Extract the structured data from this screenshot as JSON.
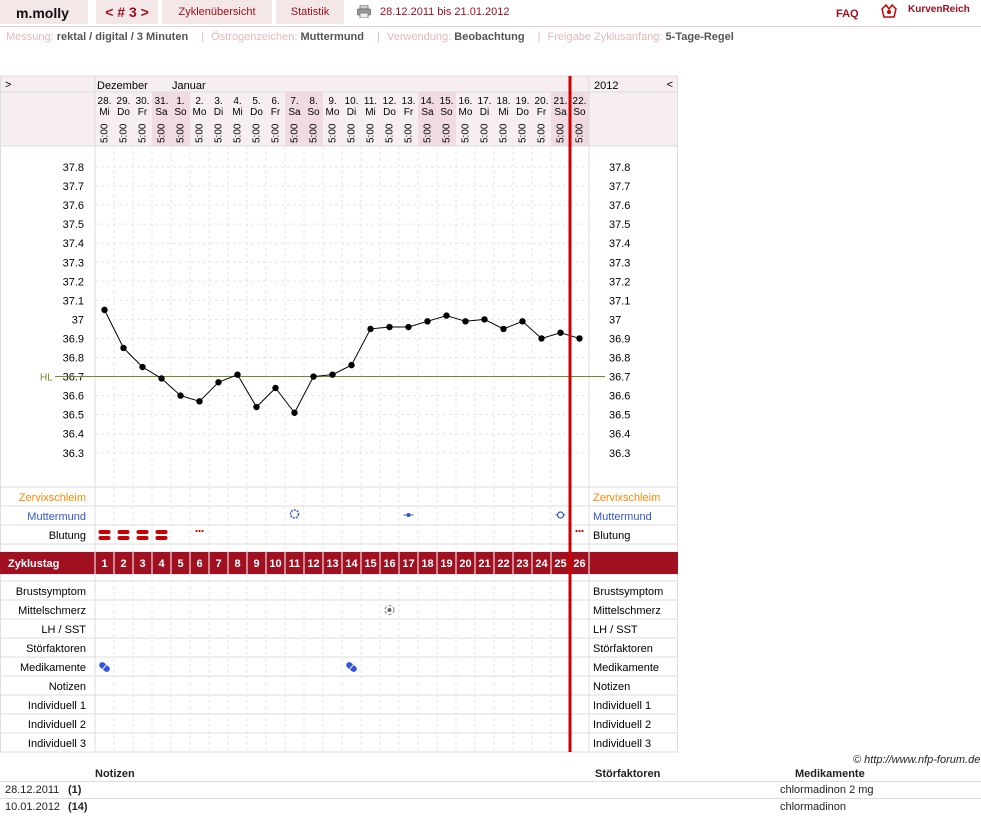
{
  "header": {
    "brand": "m.molly",
    "nav_label": "< # 3 >",
    "tab_overview": "Zyklenübersicht",
    "tab_stats": "Statistik",
    "date_range": "28.12.2011 bis 21.01.2012",
    "faq": "FAQ",
    "logo_text": "KurvenReich",
    "accent_color": "#a01020"
  },
  "info": {
    "measure_label": "Messung:",
    "measure_value": "rektal / digital / 3 Minuten",
    "estro_label": "Östrogenzeichen:",
    "estro_value": "Muttermund",
    "usage_label": "Verwendung:",
    "usage_value": "Beobachtung",
    "release_label": "Freigabe Zyklusanfang:",
    "release_value": "5-Tage-Regel"
  },
  "chart_data": {
    "type": "line",
    "left_marker": ">",
    "right_marker": "<",
    "month_labels": [
      "Dezember",
      "Januar"
    ],
    "year_label": "2012",
    "days": [
      {
        "date": "28.",
        "wd": "Mi",
        "time": "5:00"
      },
      {
        "date": "29.",
        "wd": "Do",
        "time": "5:00"
      },
      {
        "date": "30.",
        "wd": "Fr",
        "time": "5:00"
      },
      {
        "date": "31.",
        "wd": "Sa",
        "time": "5:00"
      },
      {
        "date": "1.",
        "wd": "So",
        "time": "5:00"
      },
      {
        "date": "2.",
        "wd": "Mo",
        "time": "5:00"
      },
      {
        "date": "3.",
        "wd": "Di",
        "time": "5:00"
      },
      {
        "date": "4.",
        "wd": "Mi",
        "time": "5:00"
      },
      {
        "date": "5.",
        "wd": "Do",
        "time": "5:00"
      },
      {
        "date": "6.",
        "wd": "Fr",
        "time": "5:00"
      },
      {
        "date": "7.",
        "wd": "Sa",
        "time": "5:00"
      },
      {
        "date": "8.",
        "wd": "So",
        "time": "5:00"
      },
      {
        "date": "9.",
        "wd": "Mo",
        "time": "5:00"
      },
      {
        "date": "10.",
        "wd": "Di",
        "time": "5:00"
      },
      {
        "date": "11.",
        "wd": "Mi",
        "time": "5:00"
      },
      {
        "date": "12.",
        "wd": "Do",
        "time": "5:00"
      },
      {
        "date": "13.",
        "wd": "Fr",
        "time": "5:00"
      },
      {
        "date": "14.",
        "wd": "Sa",
        "time": "5:00"
      },
      {
        "date": "15.",
        "wd": "So",
        "time": "5:00"
      },
      {
        "date": "16.",
        "wd": "Mo",
        "time": "5:00"
      },
      {
        "date": "17.",
        "wd": "Di",
        "time": "5:00"
      },
      {
        "date": "18.",
        "wd": "Mi",
        "time": "5:00"
      },
      {
        "date": "19.",
        "wd": "Do",
        "time": "5:00"
      },
      {
        "date": "20.",
        "wd": "Fr",
        "time": "5:00"
      },
      {
        "date": "21.",
        "wd": "Sa",
        "time": "5:00"
      },
      {
        "date": "22.",
        "wd": "So",
        "time": "5:00"
      }
    ],
    "cycle_days": [
      1,
      2,
      3,
      4,
      5,
      6,
      7,
      8,
      9,
      10,
      11,
      12,
      13,
      14,
      15,
      16,
      17,
      18,
      19,
      20,
      21,
      22,
      23,
      24,
      25,
      26
    ],
    "temperatures": [
      37.05,
      36.85,
      36.75,
      36.69,
      36.6,
      36.57,
      36.67,
      36.71,
      36.54,
      36.64,
      36.51,
      36.7,
      36.71,
      36.76,
      36.95,
      36.96,
      36.96,
      36.99,
      37.02,
      36.99,
      37.0,
      36.95,
      36.99,
      36.9,
      36.93,
      36.9
    ],
    "y_ticks": [
      "37.8",
      "37.7",
      "37.6",
      "37.5",
      "37.4",
      "37.3",
      "37.2",
      "37.1",
      "37",
      "36.9",
      "36.8",
      "36.7",
      "36.6",
      "36.5",
      "36.4",
      "36.3"
    ],
    "ylim": [
      36.3,
      37.8
    ],
    "hl_label": "HL",
    "hl_value": 36.7,
    "hl_color": "#6b8e23",
    "line_color": "#000000",
    "cycle_start_marker_day": 26,
    "marker_color": "#cc0000",
    "row_labels": {
      "zervix": "Zervixschleim",
      "mumu": "Muttermund",
      "blutung": "Blutung",
      "zyklustag": "Zyklustag",
      "brust": "Brustsymptom",
      "mittel": "Mittelschmerz",
      "lh": "LH / SST",
      "stoer": "Störfaktoren",
      "medi": "Medikamente",
      "notizen": "Notizen",
      "ind1": "Individuell 1",
      "ind2": "Individuell 2",
      "ind3": "Individuell 3"
    },
    "zervix_color": "#ff8800",
    "mumu_color": "#3355cc",
    "bleeding": [
      {
        "day": 1,
        "type": "heavy"
      },
      {
        "day": 2,
        "type": "heavy"
      },
      {
        "day": 3,
        "type": "heavy"
      },
      {
        "day": 4,
        "type": "heavy"
      },
      {
        "day": 6,
        "type": "spotting"
      },
      {
        "day": 26,
        "type": "spotting"
      }
    ],
    "muttermund": [
      {
        "day": 11,
        "type": "open"
      },
      {
        "day": 17,
        "type": "closed"
      },
      {
        "day": 25,
        "type": "medium"
      }
    ],
    "mittelschmerz_days": [
      16
    ],
    "medication_days": [
      1,
      14
    ]
  },
  "notes": {
    "h_notes": "Notizen",
    "h_stoer": "Störfaktoren",
    "h_medi": "Medikamente",
    "credit": "© http://www.nfp-forum.de",
    "rows": [
      {
        "date": "28.12.2011",
        "day": "(1)",
        "medi": "chlormadinon 2 mg"
      },
      {
        "date": "10.01.2012",
        "day": "(14)",
        "medi": "chlormadinon"
      }
    ]
  }
}
